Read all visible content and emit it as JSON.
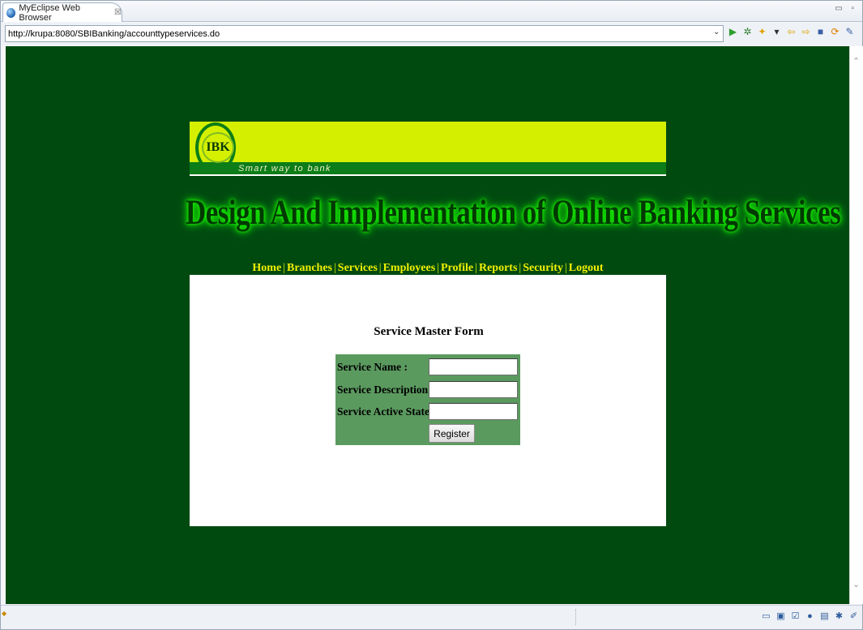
{
  "browser": {
    "tab_title": "MyEclipse Web Browser",
    "tab_close": "☒",
    "window_controls": "▭ ▫",
    "url": "http://krupa:8080/SBIBanking/accounttypeservices.do",
    "url_dropdown": "⌄",
    "toolbar": [
      {
        "name": "go-icon",
        "glyph": "▶",
        "color": "#2e9e2e"
      },
      {
        "name": "debug-icon",
        "glyph": "✲",
        "color": "#2e7d32"
      },
      {
        "name": "tools-icon",
        "glyph": "✦",
        "color": "#e0a000"
      },
      {
        "name": "dropdown-arrow-icon",
        "glyph": "▾",
        "color": "#333333"
      },
      {
        "name": "back-icon",
        "glyph": "⇦",
        "color": "#e0a000"
      },
      {
        "name": "forward-icon",
        "glyph": "⇨",
        "color": "#e0a000"
      },
      {
        "name": "stop-icon",
        "glyph": "■",
        "color": "#3a5fa8"
      },
      {
        "name": "refresh-icon",
        "glyph": "⟳",
        "color": "#e07b00"
      },
      {
        "name": "edit-icon",
        "glyph": "✎",
        "color": "#3a5fa8"
      }
    ],
    "status_icons": [
      "▭",
      "▣",
      "☑",
      "●",
      "▤",
      "✱",
      "✐"
    ]
  },
  "site": {
    "logo_text": "IBK",
    "tagline": "Smart way to bank",
    "title": "Design And Implementation of  Online Banking Services",
    "nav": [
      {
        "name": "nav-home",
        "label": "Home"
      },
      {
        "name": "nav-branches",
        "label": "Branches"
      },
      {
        "name": "nav-services",
        "label": "Services"
      },
      {
        "name": "nav-employees",
        "label": "Employees"
      },
      {
        "name": "nav-profile",
        "label": "Profile"
      },
      {
        "name": "nav-reports",
        "label": "Reports"
      },
      {
        "name": "nav-security",
        "label": "Security"
      },
      {
        "name": "nav-logout",
        "label": "Logout"
      }
    ],
    "nav_separator": "|"
  },
  "form": {
    "title": "Service Master Form",
    "fields": [
      {
        "label": "Service Name :",
        "value": ""
      },
      {
        "label": "Service Description :",
        "value": ""
      },
      {
        "label": "Service Active State :",
        "value": ""
      }
    ],
    "submit_label": "Register"
  },
  "colors": {
    "background": "#004a10",
    "banner_accent": "#d4f000",
    "banner_green": "#0c7d18",
    "form_box": "#5b9a5f",
    "nav_text": "#f2f000"
  }
}
